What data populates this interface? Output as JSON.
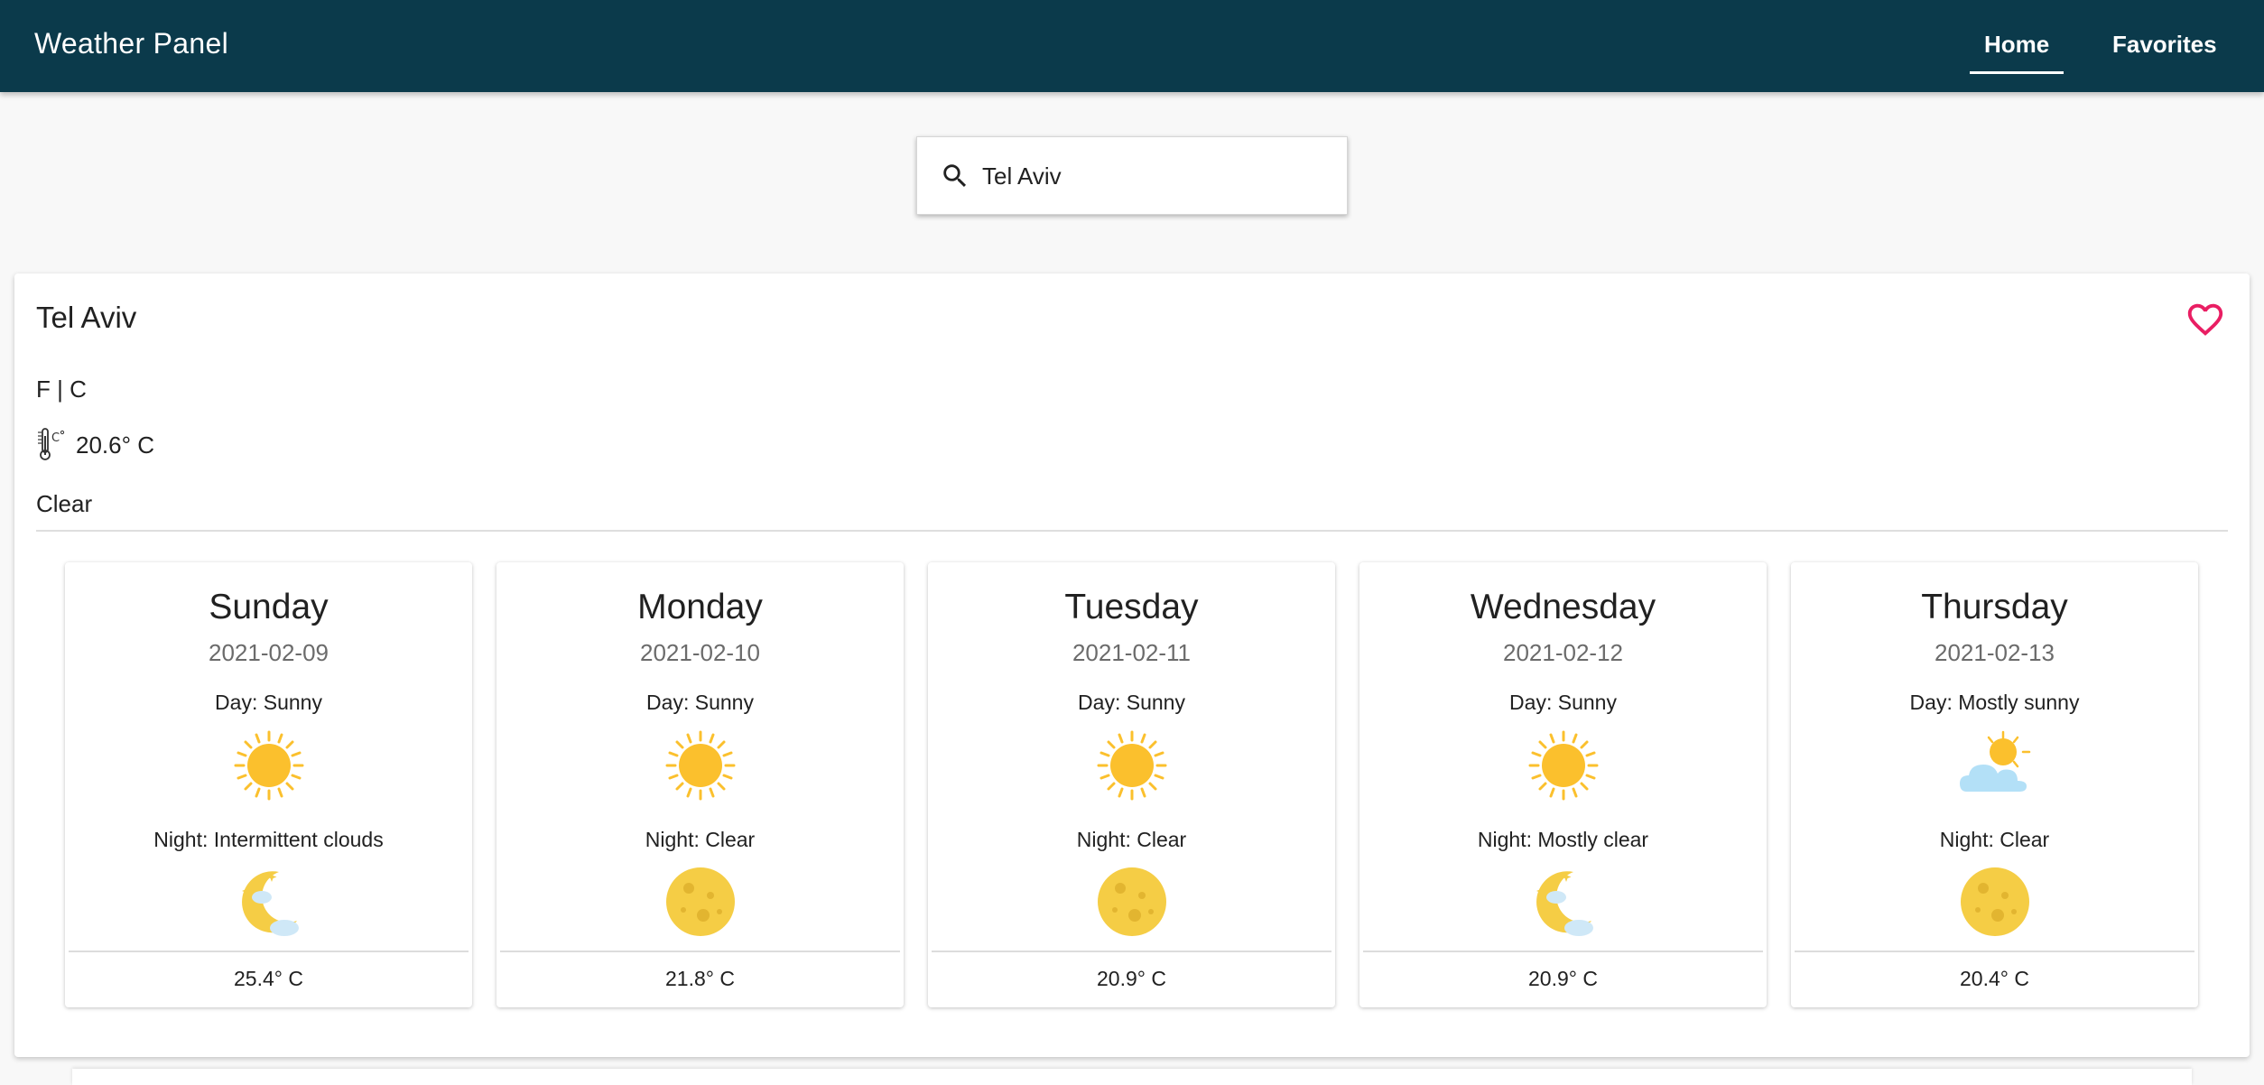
{
  "app": {
    "title": "Weather Panel"
  },
  "nav": {
    "home": "Home",
    "favorites": "Favorites",
    "active": "Home"
  },
  "search": {
    "value": "Tel Aviv",
    "icon": "search-icon"
  },
  "current": {
    "city": "Tel Aviv",
    "unit_toggle": "F | C",
    "temperature": "20.6° C",
    "condition": "Clear",
    "favorite_color": "#e91e63"
  },
  "forecast": [
    {
      "day": "Sunday",
      "date": "2021-02-09",
      "day_condition": "Day: Sunny",
      "day_icon": "sun-icon",
      "night_condition": "Night: Intermittent clouds",
      "night_icon": "moon-clouds-icon",
      "temperature": "25.4° C"
    },
    {
      "day": "Monday",
      "date": "2021-02-10",
      "day_condition": "Day: Sunny",
      "day_icon": "sun-icon",
      "night_condition": "Night: Clear",
      "night_icon": "full-moon-icon",
      "temperature": "21.8° C"
    },
    {
      "day": "Tuesday",
      "date": "2021-02-11",
      "day_condition": "Day: Sunny",
      "day_icon": "sun-icon",
      "night_condition": "Night: Clear",
      "night_icon": "full-moon-icon",
      "temperature": "20.9° C"
    },
    {
      "day": "Wednesday",
      "date": "2021-02-12",
      "day_condition": "Day: Sunny",
      "day_icon": "sun-icon",
      "night_condition": "Night: Mostly clear",
      "night_icon": "moon-clouds-icon",
      "temperature": "20.9° C"
    },
    {
      "day": "Thursday",
      "date": "2021-02-13",
      "day_condition": "Day: Mostly sunny",
      "day_icon": "sun-cloud-icon",
      "night_condition": "Night: Clear",
      "night_icon": "full-moon-icon",
      "temperature": "20.4° C"
    }
  ],
  "colors": {
    "appbar": "#0b3a4b",
    "sun": "#fbc02d",
    "moon": "#f5cd45",
    "heart": "#e91e63"
  }
}
